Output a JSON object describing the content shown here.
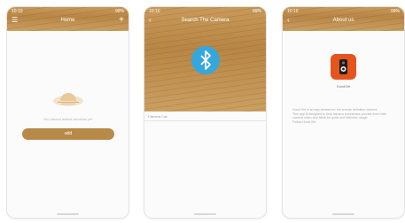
{
  "status": {
    "time": "10:10",
    "battery": "99%"
  },
  "screens": {
    "home": {
      "title": "Home",
      "message": "You havent added cameras yet",
      "add_label": "add"
    },
    "search": {
      "title": "Search The Camera",
      "found_label": "Camera List"
    },
    "about": {
      "title": "About us",
      "app_name": "HundSirt",
      "description": [
        "Hund Sirt is an app created for the remote definition camera.",
        "This app is designed to help camera technicians provide them with camera video and allow for quick and effective usage.",
        "Follow Hund Sirt"
      ]
    }
  },
  "colors": {
    "wood": "#b88645",
    "accent": "#35a7de",
    "app_icon": "#e4541d"
  },
  "icons": [
    "menu-icon",
    "plus-icon",
    "back-icon",
    "bluetooth-icon",
    "speaker-icon"
  ]
}
